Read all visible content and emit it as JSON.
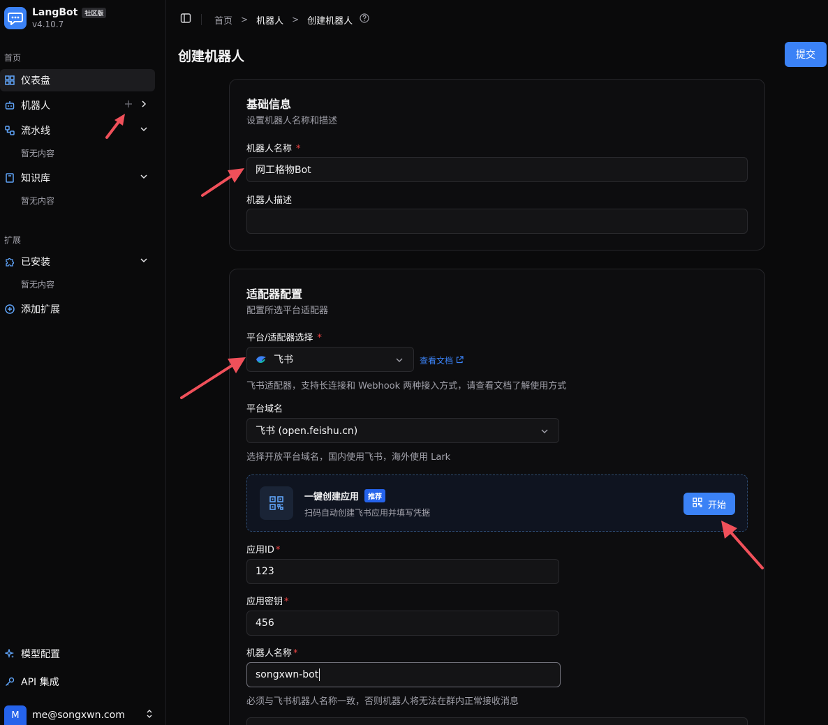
{
  "brand": {
    "name": "LangBot",
    "badge": "社区版",
    "version": "v4.10.7"
  },
  "sidebar": {
    "home_label": "首页",
    "items": [
      {
        "label": "仪表盘"
      },
      {
        "label": "机器人"
      },
      {
        "label": "流水线",
        "empty": "暂无内容"
      },
      {
        "label": "知识库",
        "empty": "暂无内容"
      }
    ],
    "ext_label": "扩展",
    "ext_items": [
      {
        "label": "已安装",
        "empty": "暂无内容"
      },
      {
        "label": "添加扩展"
      }
    ],
    "bottom_items": [
      {
        "label": "模型配置"
      },
      {
        "label": "API 集成"
      }
    ],
    "user": {
      "initial": "M",
      "email": "me@songxwn.com"
    }
  },
  "breadcrumb": {
    "home": "首页",
    "bots": "机器人",
    "current": "创建机器人"
  },
  "page": {
    "title": "创建机器人",
    "submit": "提交"
  },
  "basic": {
    "title": "基础信息",
    "desc": "设置机器人名称和描述",
    "name_label": "机器人名称",
    "required_mark": "*",
    "name_value": "网工格物Bot",
    "desc_label": "机器人描述",
    "desc_value": ""
  },
  "adapter": {
    "title": "适配器配置",
    "desc": "配置所选平台适配器",
    "platform_label": "平台/适配器选择",
    "platform_value": "飞书",
    "doc_link": "查看文档",
    "platform_hint": "飞书适配器，支持长连接和 Webhook 两种接入方式，请查看文档了解使用方式",
    "domain_label": "平台域名",
    "domain_value": "飞书 (open.feishu.cn)",
    "domain_hint": "选择开放平台域名，国内使用飞书，海外使用 Lark",
    "quick": {
      "title": "一键创建应用",
      "badge": "推荐",
      "desc": "扫码自动创建飞书应用并填写凭据",
      "button": "开始"
    },
    "app_id_label": "应用ID",
    "app_id_value": "123",
    "app_secret_label": "应用密钥",
    "app_secret_value": "456",
    "bot_name_label": "机器人名称",
    "bot_name_value": "songxwn-bot",
    "bot_name_hint": "必须与飞书机器人名称一致，否则机器人将无法在群内正常接收消息"
  },
  "colors": {
    "accent": "#3b82f6",
    "required": "#ef4444",
    "annotation_arrow": "#f0505a"
  }
}
